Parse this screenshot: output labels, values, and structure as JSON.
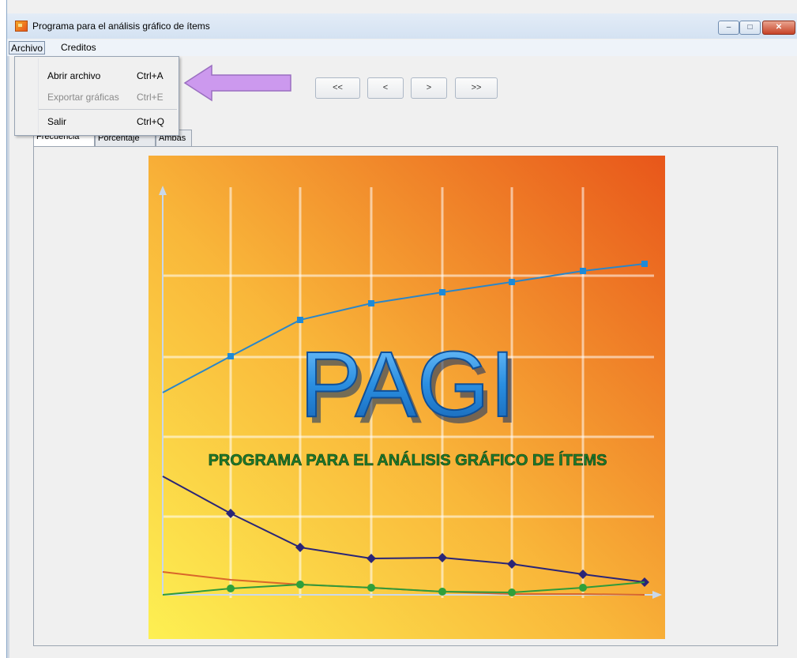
{
  "window": {
    "title": "Programa para el análisis gráfico de ítems",
    "controls": {
      "minimize": "–",
      "maximize": "□",
      "close": "✕"
    }
  },
  "menubar": {
    "items": [
      "Archivo",
      "Creditos"
    ]
  },
  "archivo_menu": [
    {
      "label": "Abrir archivo",
      "shortcut": "Ctrl+A",
      "enabled": true
    },
    {
      "label": "Exportar gráficas",
      "shortcut": "Ctrl+E",
      "enabled": false
    },
    {
      "label": "Salir",
      "shortcut": "Ctrl+Q",
      "enabled": true
    }
  ],
  "nav_buttons": [
    "<<",
    "<",
    ">",
    ">>"
  ],
  "tabs": [
    "Frecuencia",
    "Porcentaje",
    "Ambas"
  ],
  "splash": {
    "logo_text": "PAGI",
    "subtitle": "PROGRAMA PARA EL ANÁLISIS GRÁFICO DE ÍTEMS"
  },
  "colors": {
    "arrow": "#cc99ee",
    "splash_orange": "#ee7a1c",
    "splash_yellow": "#fde552",
    "logo_blue": "#2a8ee0",
    "subtitle_green": "#1f7a2a"
  },
  "icons": {
    "app": "pagi-app-icon",
    "arrow": "left-arrow-icon"
  }
}
